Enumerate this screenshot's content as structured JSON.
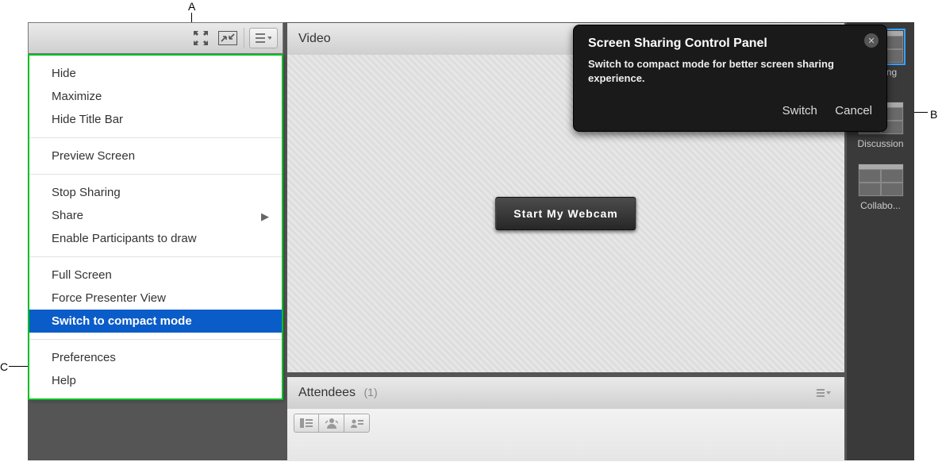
{
  "callouts": {
    "a": "A",
    "b": "B",
    "c": "C"
  },
  "toolbar": {
    "fullscreen_icon": "fullscreen",
    "compact_icon": "compact-mode",
    "options_icon": "pod-options"
  },
  "menu": {
    "group1": {
      "hide": "Hide",
      "maximize": "Maximize",
      "hide_title_bar": "Hide Title Bar"
    },
    "group2": {
      "preview_screen": "Preview Screen"
    },
    "group3": {
      "stop_sharing": "Stop Sharing",
      "share": "Share",
      "enable_draw": "Enable Participants to draw"
    },
    "group4": {
      "full_screen": "Full Screen",
      "force_presenter": "Force Presenter View",
      "switch_compact": "Switch to compact mode"
    },
    "group5": {
      "preferences": "Preferences",
      "help": "Help"
    }
  },
  "video_pod": {
    "title": "Video",
    "start_webcam": "Start My Webcam"
  },
  "attendees_pod": {
    "title": "Attendees",
    "count": "(1)"
  },
  "layouts": {
    "l1": "Sharing",
    "l2": "Discussion",
    "l3": "Collabo..."
  },
  "dialog": {
    "title": "Screen Sharing Control Panel",
    "message": "Switch to compact mode for better screen sharing experience.",
    "switch": "Switch",
    "cancel": "Cancel"
  }
}
